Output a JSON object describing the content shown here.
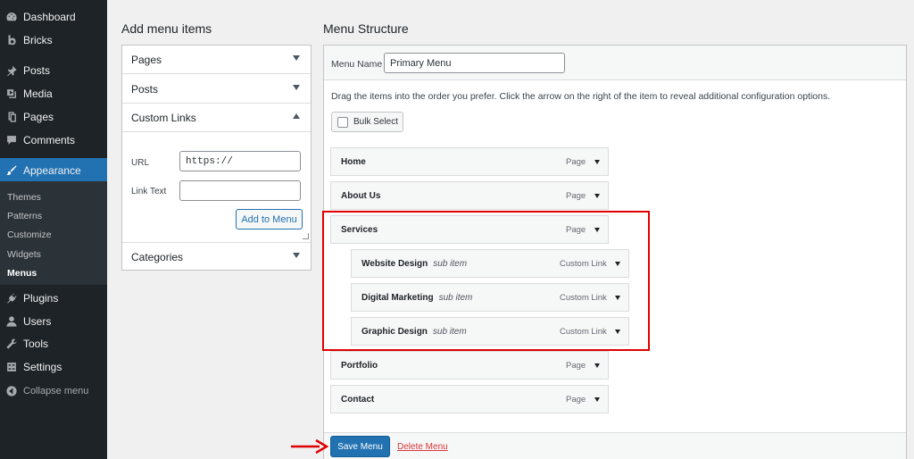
{
  "sidebar": {
    "items": [
      {
        "label": "Dashboard",
        "icon": "dashboard-icon"
      },
      {
        "label": "Bricks",
        "icon": "bricks-icon"
      },
      {
        "label": "Posts",
        "icon": "pin-icon"
      },
      {
        "label": "Media",
        "icon": "media-icon"
      },
      {
        "label": "Pages",
        "icon": "pages-icon"
      },
      {
        "label": "Comments",
        "icon": "comment-icon"
      },
      {
        "label": "Appearance",
        "icon": "brush-icon",
        "active": true
      },
      {
        "label": "Plugins",
        "icon": "plug-icon"
      },
      {
        "label": "Users",
        "icon": "user-icon"
      },
      {
        "label": "Tools",
        "icon": "wrench-icon"
      },
      {
        "label": "Settings",
        "icon": "settings-icon"
      },
      {
        "label": "Collapse menu",
        "icon": "collapse-icon"
      }
    ],
    "submenu": [
      "Themes",
      "Patterns",
      "Customize",
      "Widgets",
      "Menus"
    ],
    "submenu_current": "Menus"
  },
  "add_items": {
    "title": "Add menu items",
    "sections": [
      "Pages",
      "Posts",
      "Custom Links",
      "Categories"
    ],
    "custom_links": {
      "url_label": "URL",
      "url_value": "https://",
      "link_text_label": "Link Text",
      "link_text_value": "",
      "add_button": "Add to Menu"
    }
  },
  "structure": {
    "title": "Menu Structure",
    "menu_name_label": "Menu Name",
    "menu_name_value": "Primary Menu",
    "instructions": "Drag the items into the order you prefer. Click the arrow on the right of the item to reveal additional configuration options.",
    "bulk_select": "Bulk Select",
    "items": [
      {
        "title": "Home",
        "type": "Page"
      },
      {
        "title": "About Us",
        "type": "Page"
      },
      {
        "title": "Services",
        "type": "Page"
      },
      {
        "title": "Website Design",
        "sub": "sub item",
        "type": "Custom Link"
      },
      {
        "title": "Digital Marketing",
        "sub": "sub item",
        "type": "Custom Link"
      },
      {
        "title": "Graphic Design",
        "sub": "sub item",
        "type": "Custom Link"
      },
      {
        "title": "Portfolio",
        "type": "Page"
      },
      {
        "title": "Contact",
        "type": "Page"
      }
    ],
    "save_button": "Save Menu",
    "delete_link": "Delete Menu"
  },
  "colors": {
    "sidebar_bg": "#1d2327",
    "accent": "#2271b1",
    "highlight": "#e00000",
    "danger": "#d63638"
  }
}
